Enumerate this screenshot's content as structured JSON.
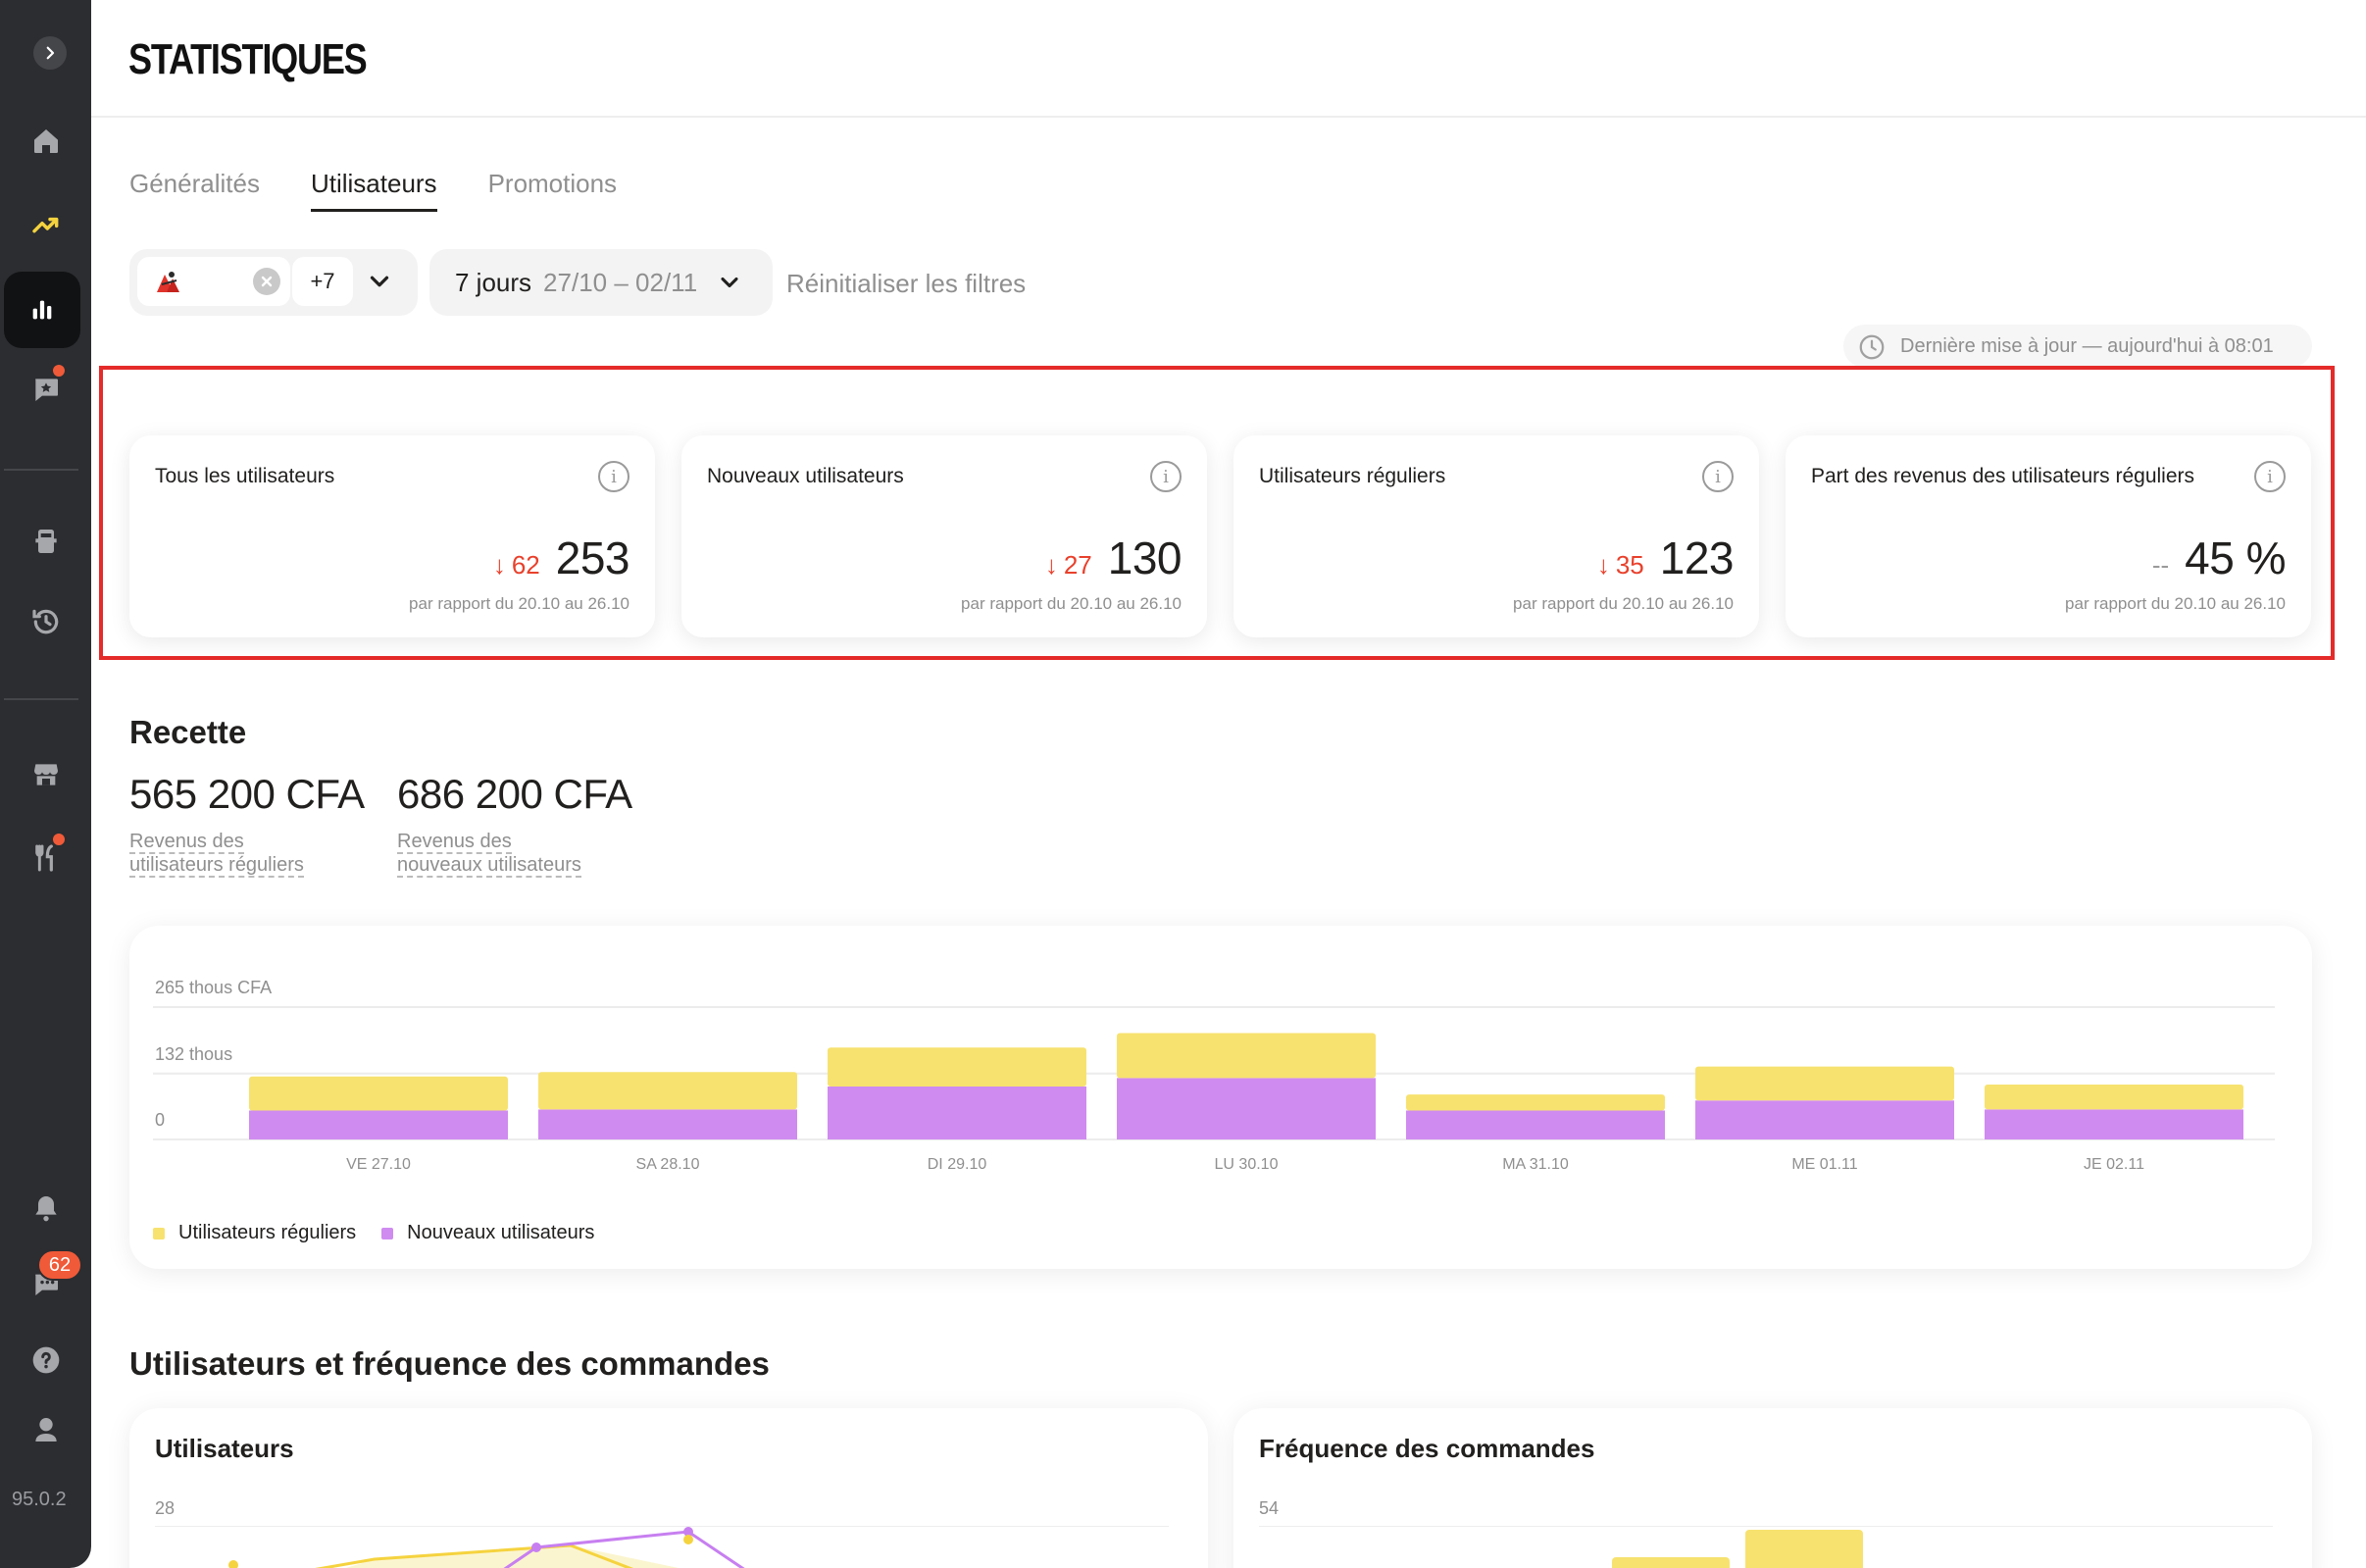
{
  "app": {
    "page_title": "STATISTIQUES",
    "version": "95.0.2"
  },
  "sidebar": {
    "toggle_icon": "chevron-right-icon",
    "items": [
      {
        "icon": "home-icon",
        "color": "#a6a7ab"
      },
      {
        "icon": "trending-up-icon",
        "color": "#f5d33f"
      },
      {
        "icon": "bar-chart-icon",
        "color": "#ffffff",
        "active": true
      },
      {
        "icon": "chat-star-icon",
        "color": "#a6a7ab",
        "badge_dot": true
      },
      {
        "icon": "tablet-icon",
        "color": "#a6a7ab"
      },
      {
        "icon": "history-icon",
        "color": "#a6a7ab"
      },
      {
        "icon": "store-icon",
        "color": "#a6a7ab"
      },
      {
        "icon": "fork-knife-icon",
        "color": "#a6a7ab",
        "badge_dot": true
      },
      {
        "icon": "bell-icon",
        "color": "#a6a7ab"
      },
      {
        "icon": "chat-icon",
        "color": "#a6a7ab",
        "badge": "62"
      },
      {
        "icon": "help-icon",
        "color": "#a6a7ab"
      },
      {
        "icon": "support-agent-icon",
        "color": "#a6a7ab"
      }
    ]
  },
  "tabs": [
    {
      "label": "Généralités",
      "active": false
    },
    {
      "label": "Utilisateurs",
      "active": true
    },
    {
      "label": "Promotions",
      "active": false
    }
  ],
  "filters": {
    "more_count": "+7",
    "date_label": "7 jours",
    "date_range": "27/10 – 02/11",
    "reset_label": "Réinitialiser les filtres"
  },
  "last_update": "Dernière mise à jour — aujourd'hui à 08:01",
  "kpis": [
    {
      "title": "Tous les utilisateurs",
      "delta": "62",
      "delta_dir": "down",
      "value": "253",
      "sub": "par rapport du 20.10 au 26.10"
    },
    {
      "title": "Nouveaux utilisateurs",
      "delta": "27",
      "delta_dir": "down",
      "value": "130",
      "sub": "par rapport du 20.10 au 26.10"
    },
    {
      "title": "Utilisateurs réguliers",
      "delta": "35",
      "delta_dir": "down",
      "value": "123",
      "sub": "par rapport du 20.10 au 26.10"
    },
    {
      "title": "Part des revenus des utilisateurs réguliers",
      "delta": "--",
      "delta_dir": "neutral",
      "value": "45 %",
      "sub": "par rapport du 20.10 au 26.10"
    }
  ],
  "recette": {
    "title": "Recette",
    "items": [
      {
        "value": "565 200 CFA",
        "label": "Revenus des utilisateurs réguliers"
      },
      {
        "value": "686 200 CFA",
        "label": "Revenus des nouveaux utilisateurs"
      }
    ]
  },
  "chart_data": {
    "type": "bar",
    "stacked": true,
    "categories": [
      "VE 27.10",
      "SA 28.10",
      "DI 29.10",
      "LU 30.10",
      "MA 31.10",
      "ME 01.11",
      "JE 02.11"
    ],
    "series": [
      {
        "name": "Nouveaux utilisateurs",
        "color": "#cf8bf0",
        "values": [
          58,
          60,
          106,
          123,
          58,
          78,
          60
        ]
      },
      {
        "name": "Utilisateurs réguliers",
        "color": "#f7e270",
        "values": [
          68,
          75,
          78,
          90,
          32,
          68,
          50
        ]
      }
    ],
    "y_ticks": [
      {
        "value": 265,
        "label": "265 thous CFA"
      },
      {
        "value": 132,
        "label": "132 thous"
      },
      {
        "value": 0,
        "label": "0"
      }
    ],
    "ylim": [
      0,
      265
    ],
    "legend": "bottom-left",
    "grid": true
  },
  "freq_section": {
    "title": "Utilisateurs et fréquence des commandes",
    "cards": [
      {
        "title": "Utilisateurs",
        "y_top": "28"
      },
      {
        "title": "Fréquence des commandes",
        "y_top": "54"
      }
    ]
  }
}
